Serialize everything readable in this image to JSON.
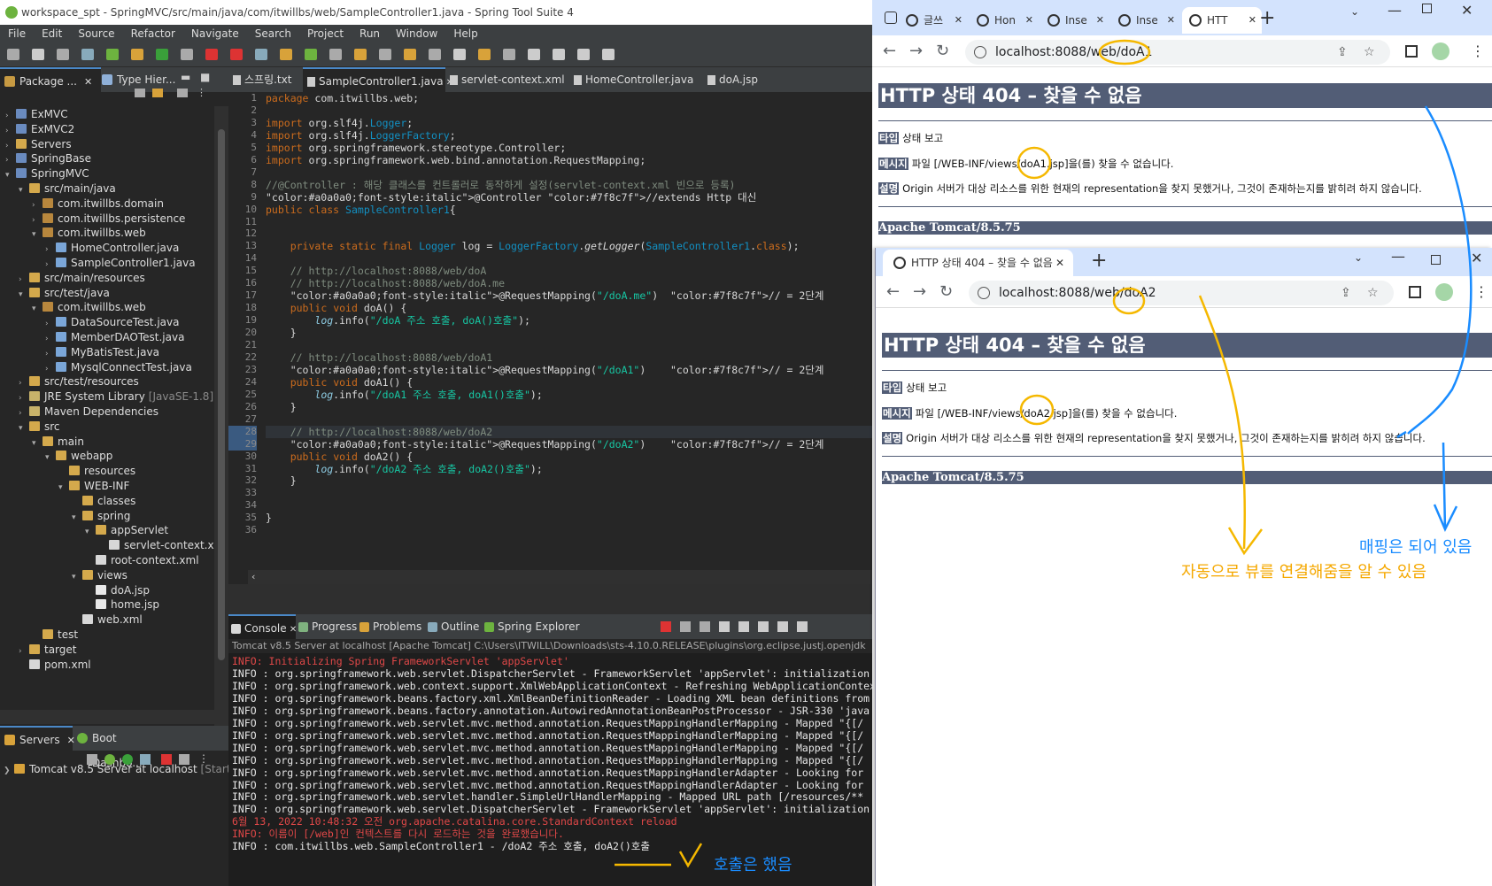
{
  "ide": {
    "title": "workspace_spt - SpringMVC/src/main/java/com/itwillbs/web/SampleController1.java - Spring Tool Suite 4",
    "menu": [
      "File",
      "Edit",
      "Source",
      "Refactor",
      "Navigate",
      "Search",
      "Project",
      "Run",
      "Window",
      "Help"
    ],
    "left_tabs": [
      "Package ...",
      "Type Hier..."
    ],
    "tree": [
      {
        "label": "ExMVC",
        "depth": 0,
        "icon": "proj",
        "open": false
      },
      {
        "label": "ExMVC2",
        "depth": 0,
        "icon": "proj",
        "open": false
      },
      {
        "label": "Servers",
        "depth": 0,
        "icon": "fold",
        "open": false
      },
      {
        "label": "SpringBase",
        "depth": 0,
        "icon": "proj",
        "open": false
      },
      {
        "label": "SpringMVC",
        "depth": 0,
        "icon": "proj",
        "open": true
      },
      {
        "label": "src/main/java",
        "depth": 1,
        "icon": "fold",
        "open": true
      },
      {
        "label": "com.itwillbs.domain",
        "depth": 2,
        "icon": "pkg",
        "open": false
      },
      {
        "label": "com.itwillbs.persistence",
        "depth": 2,
        "icon": "pkg",
        "open": false
      },
      {
        "label": "com.itwillbs.web",
        "depth": 2,
        "icon": "pkg",
        "open": true
      },
      {
        "label": "HomeController.java",
        "depth": 3,
        "icon": "java",
        "open": false
      },
      {
        "label": "SampleController1.java",
        "depth": 3,
        "icon": "java",
        "open": false
      },
      {
        "label": "src/main/resources",
        "depth": 1,
        "icon": "fold",
        "open": false
      },
      {
        "label": "src/test/java",
        "depth": 1,
        "icon": "fold",
        "open": true
      },
      {
        "label": "com.itwillbs.web",
        "depth": 2,
        "icon": "pkg",
        "open": true
      },
      {
        "label": "DataSourceTest.java",
        "depth": 3,
        "icon": "java",
        "open": false
      },
      {
        "label": "MemberDAOTest.java",
        "depth": 3,
        "icon": "java",
        "open": false
      },
      {
        "label": "MyBatisTest.java",
        "depth": 3,
        "icon": "java",
        "open": false
      },
      {
        "label": "MysqlConnectTest.java",
        "depth": 3,
        "icon": "java",
        "open": false
      },
      {
        "label": "src/test/resources",
        "depth": 1,
        "icon": "fold",
        "open": false
      },
      {
        "label": "JRE System Library",
        "depth": 1,
        "icon": "lib",
        "open": false,
        "suffix": "[JavaSE-1.8]"
      },
      {
        "label": "Maven Dependencies",
        "depth": 1,
        "icon": "lib",
        "open": false
      },
      {
        "label": "src",
        "depth": 1,
        "icon": "fold",
        "open": true
      },
      {
        "label": "main",
        "depth": 2,
        "icon": "fold",
        "open": true
      },
      {
        "label": "webapp",
        "depth": 3,
        "icon": "fold",
        "open": true
      },
      {
        "label": "resources",
        "depth": 4,
        "icon": "fold",
        "open": null
      },
      {
        "label": "WEB-INF",
        "depth": 4,
        "icon": "fold",
        "open": true
      },
      {
        "label": "classes",
        "depth": 5,
        "icon": "fold",
        "open": null
      },
      {
        "label": "spring",
        "depth": 5,
        "icon": "fold",
        "open": true
      },
      {
        "label": "appServlet",
        "depth": 6,
        "icon": "fold",
        "open": true
      },
      {
        "label": "servlet-context.xml",
        "depth": 7,
        "icon": "xml",
        "open": null
      },
      {
        "label": "root-context.xml",
        "depth": 6,
        "icon": "xml",
        "open": null
      },
      {
        "label": "views",
        "depth": 5,
        "icon": "fold",
        "open": true
      },
      {
        "label": "doA.jsp",
        "depth": 6,
        "icon": "jsp",
        "open": null
      },
      {
        "label": "home.jsp",
        "depth": 6,
        "icon": "jsp",
        "open": null
      },
      {
        "label": "web.xml",
        "depth": 5,
        "icon": "xml",
        "open": null
      },
      {
        "label": "test",
        "depth": 2,
        "icon": "fold",
        "open": null
      },
      {
        "label": "target",
        "depth": 1,
        "icon": "fold",
        "open": false
      },
      {
        "label": "pom.xml",
        "depth": 1,
        "icon": "xml",
        "open": null
      }
    ],
    "servers_tabs": [
      "Servers",
      "Boot Dashbo..."
    ],
    "server_entry": "Tomcat v8.5 Server at localhost",
    "server_status": "[Started",
    "editor_tabs": [
      "스프링.txt",
      "SampleController1.java",
      "servlet-context.xml",
      "HomeController.java",
      "doA.jsp"
    ],
    "code": [
      {
        "n": "1",
        "t": "package com.itwillbs.web;"
      },
      {
        "n": "2",
        "t": ""
      },
      {
        "n": "3",
        "t": "import org.slf4j.Logger;"
      },
      {
        "n": "4",
        "t": "import org.slf4j.LoggerFactory;"
      },
      {
        "n": "5",
        "t": "import org.springframework.stereotype.Controller;"
      },
      {
        "n": "6",
        "t": "import org.springframework.web.bind.annotation.RequestMapping;"
      },
      {
        "n": "7",
        "t": ""
      },
      {
        "n": "8",
        "t": "//@Controller : 해당 클래스를 컨트롤러로 동작하게 설정(servlet-context.xml 빈으로 등록)"
      },
      {
        "n": "9",
        "t": "@Controller //extends Http 대신"
      },
      {
        "n": "10",
        "t": "public class SampleController1{"
      },
      {
        "n": "11",
        "t": ""
      },
      {
        "n": "12",
        "t": ""
      },
      {
        "n": "13",
        "t": "    private static final Logger log = LoggerFactory.getLogger(SampleController1.class);"
      },
      {
        "n": "14",
        "t": ""
      },
      {
        "n": "15",
        "t": "    // http://localhost:8088/web/doA"
      },
      {
        "n": "16",
        "t": "    // http://localhost:8088/web/doA.me"
      },
      {
        "n": "17",
        "t": "    @RequestMapping(\"/doA.me\")  // = 2단계"
      },
      {
        "n": "18",
        "t": "    public void doA() {"
      },
      {
        "n": "19",
        "t": "        log.info(\"/doA 주소 호출, doA()호출\");"
      },
      {
        "n": "20",
        "t": "    }"
      },
      {
        "n": "21",
        "t": ""
      },
      {
        "n": "22",
        "t": "    // http://localhost:8088/web/doA1"
      },
      {
        "n": "23",
        "t": "    @RequestMapping(\"/doA1\")    // = 2단계"
      },
      {
        "n": "24",
        "t": "    public void doA1() {"
      },
      {
        "n": "25",
        "t": "        log.info(\"/doA1 주소 호출, doA1()호출\");"
      },
      {
        "n": "26",
        "t": "    }"
      },
      {
        "n": "27",
        "t": ""
      },
      {
        "n": "28",
        "t": "    // http://localhost:8088/web/doA2"
      },
      {
        "n": "29",
        "t": "    @RequestMapping(\"/doA2\")    // = 2단계"
      },
      {
        "n": "30",
        "t": "    public void doA2() {"
      },
      {
        "n": "31",
        "t": "        log.info(\"/doA2 주소 호출, doA2()호출\");"
      },
      {
        "n": "32",
        "t": "    }"
      },
      {
        "n": "33",
        "t": ""
      },
      {
        "n": "34",
        "t": ""
      },
      {
        "n": "35",
        "t": "}"
      },
      {
        "n": "36",
        "t": ""
      }
    ],
    "console_tabs": [
      "Console",
      "Progress",
      "Problems",
      "Outline",
      "Spring Explorer"
    ],
    "console_header": "Tomcat v8.5 Server at localhost [Apache Tomcat] C:\\Users\\ITWILL\\Downloads\\sts-4.10.0.RELEASE\\plugins\\org.eclipse.justj.openjdk",
    "console_lines": [
      {
        "t": "INFO: Initializing Spring FrameworkServlet 'appServlet'",
        "red": true
      },
      {
        "t": "INFO : org.springframework.web.servlet.DispatcherServlet - FrameworkServlet 'appServlet': initialization",
        "red": false
      },
      {
        "t": "INFO : org.springframework.web.context.support.XmlWebApplicationContext - Refreshing WebApplicationContext",
        "red": false
      },
      {
        "t": "INFO : org.springframework.beans.factory.xml.XmlBeanDefinitionReader - Loading XML bean definitions from",
        "red": false
      },
      {
        "t": "INFO : org.springframework.beans.factory.annotation.AutowiredAnnotationBeanPostProcessor - JSR-330 'java",
        "red": false
      },
      {
        "t": "INFO : org.springframework.web.servlet.mvc.method.annotation.RequestMappingHandlerMapping - Mapped \"{[/",
        "red": false
      },
      {
        "t": "INFO : org.springframework.web.servlet.mvc.method.annotation.RequestMappingHandlerMapping - Mapped \"{[/",
        "red": false
      },
      {
        "t": "INFO : org.springframework.web.servlet.mvc.method.annotation.RequestMappingHandlerMapping - Mapped \"{[/",
        "red": false
      },
      {
        "t": "INFO : org.springframework.web.servlet.mvc.method.annotation.RequestMappingHandlerMapping - Mapped \"{[/",
        "red": false
      },
      {
        "t": "INFO : org.springframework.web.servlet.mvc.method.annotation.RequestMappingHandlerAdapter - Looking for",
        "red": false
      },
      {
        "t": "INFO : org.springframework.web.servlet.mvc.method.annotation.RequestMappingHandlerAdapter - Looking for",
        "red": false
      },
      {
        "t": "INFO : org.springframework.web.servlet.handler.SimpleUrlHandlerMapping - Mapped URL path [/resources/**",
        "red": false
      },
      {
        "t": "INFO : org.springframework.web.servlet.DispatcherServlet - FrameworkServlet 'appServlet': initialization",
        "red": false
      },
      {
        "t": "6월 13, 2022 10:48:32 오전 org.apache.catalina.core.StandardContext reload",
        "red": true
      },
      {
        "t": "INFO: 이름이 [/web]인 컨텍스트를 다시 로드하는 것을 완료했습니다.",
        "red": true
      },
      {
        "t": "INFO : com.itwillbs.web.SampleController1 - /doA2 주소 호출, doA2()호출",
        "red": false
      }
    ]
  },
  "browser1": {
    "tabs": [
      "글쓰",
      "Hon",
      "Inse",
      "Inse",
      "HTT"
    ],
    "url": "localhost:8088/web/doA1",
    "heading": "HTTP 상태 404 – 찾을 수 없음",
    "type_label": "타입",
    "type_value": "상태 보고",
    "message_label": "메시지",
    "message_value": "파일 [/WEB-INF/views/doA1.jsp]을(를) 찾을 수 없습니다.",
    "desc_label": "설명",
    "desc_value": "Origin 서버가 대상 리소스를 위한 현재의 representation을 찾지 못했거나, 그것이 존재하는지를 밝히려 하지 않습니다.",
    "footer": "Apache Tomcat/8.5.75"
  },
  "browser2": {
    "tab": "HTTP 상태 404 – 찾을 수 없음",
    "url": "localhost:8088/web/doA2",
    "heading": "HTTP 상태 404 – 찾을 수 없음",
    "type_label": "타입",
    "type_value": "상태 보고",
    "message_label": "메시지",
    "message_value": "파일 [/WEB-INF/views/doA2.jsp]을(를) 찾을 수 없습니다.",
    "desc_label": "설명",
    "desc_value": "Origin 서버가 대상 리소스를 위한 현재의 representation을 찾지 못했거나, 그것이 존재하는지를 밝히려 하지 않습니다.",
    "footer": "Apache Tomcat/8.5.75"
  },
  "annotations": {
    "mapped": "매핑은 되어 있음",
    "auto_view": "자동으로 뷰를 연결해줌을 알 수 있음",
    "called": "호출은 했음"
  },
  "colors": {
    "note_blue": "#1a8cff",
    "note_orange": "#f5a800",
    "tomcat_header": "#525d76"
  }
}
